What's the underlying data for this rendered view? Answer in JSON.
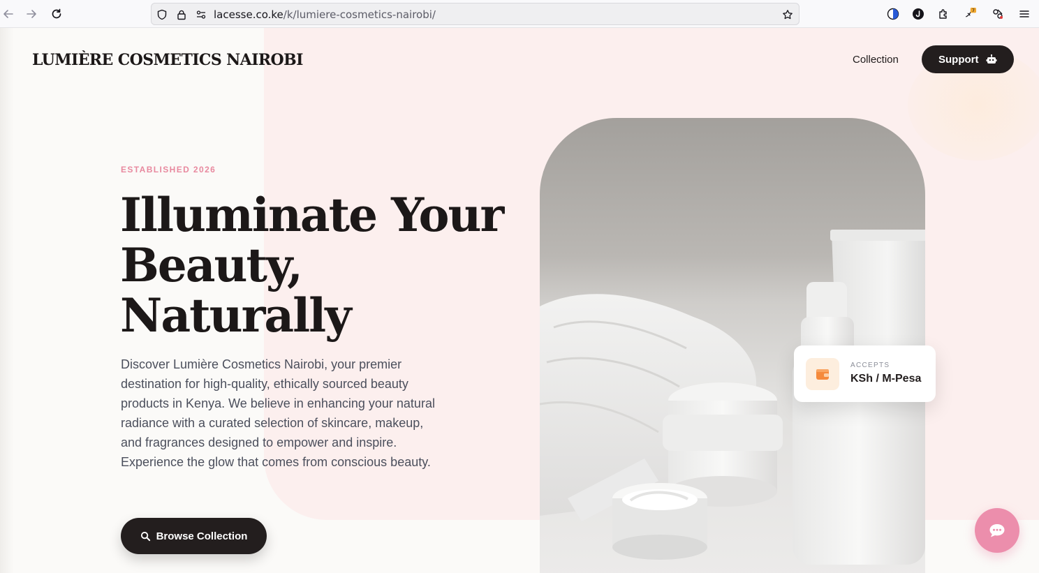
{
  "browser": {
    "url_domain": "lacesse.co.ke",
    "url_path": "/k/lumiere-cosmetics-nairobi/",
    "extension_badge": "7"
  },
  "header": {
    "brand": "LUMIÈRE COSMETICS NAIROBI",
    "nav_collection": "Collection",
    "support_label": "Support"
  },
  "hero": {
    "eyebrow": "ESTABLISHED 2026",
    "headline_line1": "Illuminate Your",
    "headline_line2": "Beauty,",
    "headline_line3": "Naturally",
    "intro": "Discover Lumière Cosmetics Nairobi, your premier destination for high-quality, ethically sourced beauty products in Kenya. We believe in enhancing your natural radiance with a curated selection of skincare, makeup, and fragrances designed to empower and inspire. Experience the glow that comes from conscious beauty.",
    "cta_label": "Browse Collection"
  },
  "payment_card": {
    "label": "ACCEPTS",
    "value": "KSh / M-Pesa"
  },
  "icons": {
    "back": "arrow-left-icon",
    "forward": "arrow-right-icon",
    "reload": "reload-icon",
    "shield": "tracking-shield-icon",
    "lock": "lock-icon",
    "permissions": "permissions-icon",
    "bookmark": "star-icon",
    "support": "robot-icon",
    "cta": "search-icon",
    "wallet": "wallet-icon",
    "chat": "chat-bubble-icon"
  },
  "colors": {
    "accent_pink": "#e8899f",
    "dark": "#231e1e",
    "panel_pink": "#fcefee",
    "chat_pink": "#ec8eac",
    "wallet_orange": "#f58a3c"
  }
}
